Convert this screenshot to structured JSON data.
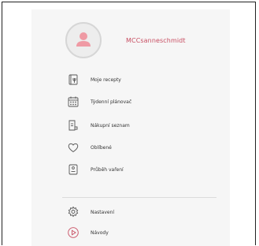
{
  "profile": {
    "username": "MCCsanneschmidt"
  },
  "menu": {
    "items": [
      {
        "label": "Moje recepty",
        "icon": "recipe-book-icon"
      },
      {
        "label": "Týdenní plánovač",
        "icon": "calendar-icon"
      },
      {
        "label": "Nákupní seznam",
        "icon": "shopping-list-icon"
      },
      {
        "label": "Oblíbené",
        "icon": "heart-icon"
      },
      {
        "label": "Průběh vaření",
        "icon": "cooking-progress-icon"
      }
    ],
    "secondary": [
      {
        "label": "Nastavení",
        "icon": "gear-icon"
      },
      {
        "label": "Návody",
        "icon": "play-icon"
      }
    ]
  },
  "colors": {
    "accent": "#c84e62",
    "panel_bg": "#f6f6f6",
    "icon_stroke": "#555555"
  }
}
